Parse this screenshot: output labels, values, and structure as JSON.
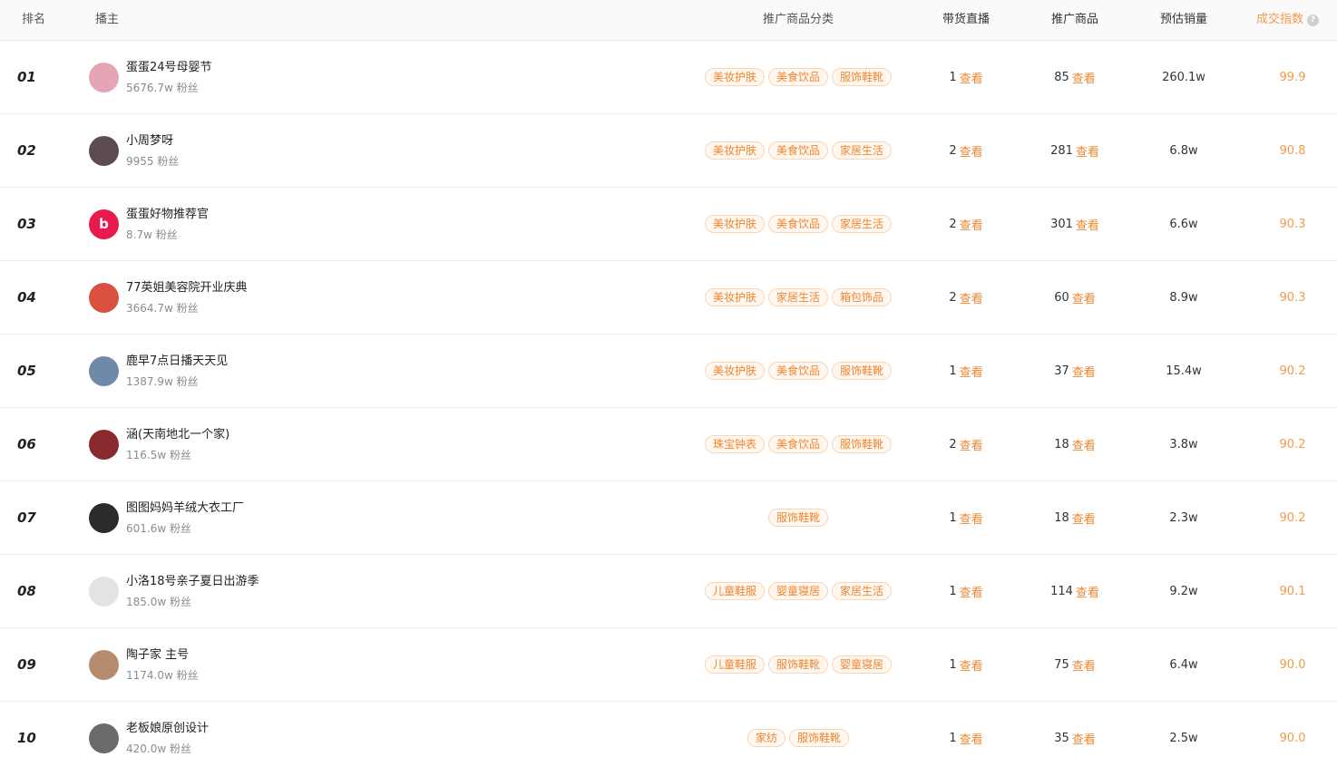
{
  "header": {
    "rank": "排名",
    "host": "播主",
    "category": "推广商品分类",
    "live": "带货直播",
    "goods": "推广商品",
    "sales": "预估销量",
    "index": "成交指数",
    "index_help": "?"
  },
  "view_label": "查看",
  "colors": {
    "accent": "#f0862e",
    "index": "#f29b4b",
    "tag_bg": "#fff7f0",
    "tag_border": "#fbd5b5"
  },
  "rows": [
    {
      "rank": "01",
      "name": "蛋蛋24号母婴节",
      "fans": "5676.7w 粉丝",
      "avatar_color": "#e6a5b4",
      "avatar_glyph": "",
      "tags": [
        "美妆护肤",
        "美食饮品",
        "服饰鞋靴"
      ],
      "live": "1",
      "goods": "85",
      "sales": "260.1w",
      "index": "99.9"
    },
    {
      "rank": "02",
      "name": "小周梦呀",
      "fans": "9955 粉丝",
      "avatar_color": "#5d4b52",
      "avatar_glyph": "",
      "tags": [
        "美妆护肤",
        "美食饮品",
        "家居生活"
      ],
      "live": "2",
      "goods": "281",
      "sales": "6.8w",
      "index": "90.8"
    },
    {
      "rank": "03",
      "name": "蛋蛋好物推荐官",
      "fans": "8.7w 粉丝",
      "avatar_color": "#e8194d",
      "avatar_glyph": "b",
      "tags": [
        "美妆护肤",
        "美食饮品",
        "家居生活"
      ],
      "live": "2",
      "goods": "301",
      "sales": "6.6w",
      "index": "90.3"
    },
    {
      "rank": "04",
      "name": "77英姐美容院开业庆典",
      "fans": "3664.7w 粉丝",
      "avatar_color": "#d9503f",
      "avatar_glyph": "",
      "tags": [
        "美妆护肤",
        "家居生活",
        "箱包饰品"
      ],
      "live": "2",
      "goods": "60",
      "sales": "8.9w",
      "index": "90.3"
    },
    {
      "rank": "05",
      "name": "鹿早7点日播天天见",
      "fans": "1387.9w 粉丝",
      "avatar_color": "#6f8aa8",
      "avatar_glyph": "",
      "tags": [
        "美妆护肤",
        "美食饮品",
        "服饰鞋靴"
      ],
      "live": "1",
      "goods": "37",
      "sales": "15.4w",
      "index": "90.2"
    },
    {
      "rank": "06",
      "name": "涵(天南地北一个家)",
      "fans": "116.5w 粉丝",
      "avatar_color": "#8a2a2e",
      "avatar_glyph": "",
      "tags": [
        "珠宝钟表",
        "美食饮品",
        "服饰鞋靴"
      ],
      "live": "2",
      "goods": "18",
      "sales": "3.8w",
      "index": "90.2"
    },
    {
      "rank": "07",
      "name": "图图妈妈羊绒大衣工厂",
      "fans": "601.6w 粉丝",
      "avatar_color": "#2b2b2b",
      "avatar_glyph": "",
      "tags": [
        "服饰鞋靴"
      ],
      "live": "1",
      "goods": "18",
      "sales": "2.3w",
      "index": "90.2"
    },
    {
      "rank": "08",
      "name": "小洛18号亲子夏日出游季",
      "fans": "185.0w 粉丝",
      "avatar_color": "#e3e3e6",
      "avatar_glyph": "",
      "tags": [
        "儿童鞋服",
        "婴童寝居",
        "家居生活"
      ],
      "live": "1",
      "goods": "114",
      "sales": "9.2w",
      "index": "90.1"
    },
    {
      "rank": "09",
      "name": "陶子家 主号",
      "fans": "1174.0w 粉丝",
      "avatar_color": "#b58d6e",
      "avatar_glyph": "",
      "tags": [
        "儿童鞋服",
        "服饰鞋靴",
        "婴童寝居"
      ],
      "live": "1",
      "goods": "75",
      "sales": "6.4w",
      "index": "90.0"
    },
    {
      "rank": "10",
      "name": "老板娘原创设计",
      "fans": "420.0w 粉丝",
      "avatar_color": "#6a6a6a",
      "avatar_glyph": "",
      "tags": [
        "家纺",
        "服饰鞋靴"
      ],
      "live": "1",
      "goods": "35",
      "sales": "2.5w",
      "index": "90.0"
    }
  ]
}
